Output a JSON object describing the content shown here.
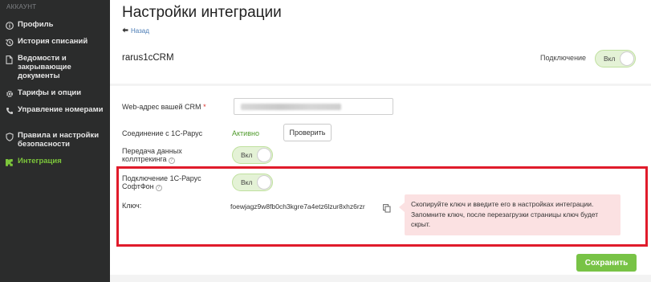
{
  "sidebar": {
    "section_label": "АККАУНТ",
    "items": [
      {
        "label": "Профиль",
        "icon": "info-circle-icon"
      },
      {
        "label": "История списаний",
        "icon": "history-icon"
      },
      {
        "label": "Ведомости и закрывающие документы",
        "icon": "document-icon"
      },
      {
        "label": "Тарифы и опции",
        "icon": "gear-icon"
      },
      {
        "label": "Управление номерами",
        "icon": "phone-icon"
      },
      {
        "label": "Правила и настройки безопасности",
        "icon": "shield-icon"
      },
      {
        "label": "Интеграция",
        "icon": "puzzle-icon",
        "active": true
      }
    ]
  },
  "header": {
    "title": "Настройки интеграции",
    "back_label": "Назад",
    "integration_name": "rarus1cCRM",
    "connection_label": "Подключение",
    "connection_toggle": "Вкл"
  },
  "form": {
    "crm_url_label": "Web-адрес вашей CRM",
    "crm_url_required_mark": "*",
    "connection_status_label": "Соединение с 1С-Рарус",
    "connection_status_value": "Активно",
    "check_button": "Проверить",
    "calltracking_label": "Передача данных коллтрекинга",
    "calltracking_toggle": "Вкл",
    "softphone_label": "Подключение 1С-Рарус СофтФон",
    "softphone_toggle": "Вкл",
    "key_label": "Ключ:",
    "key_value": "foewjagz9w8fb0ch3kgre7a4etz6lzur8xhz6rzr",
    "key_hint": "Скопируйте ключ и введите его в настройках интеграции. Запомните ключ, после перезагрузки страницы ключ будет скрыт."
  },
  "actions": {
    "save_label": "Сохранить"
  },
  "colors": {
    "sidebar_bg": "#2b2c2c",
    "active_green": "#7cc63b",
    "save_green": "#78c346",
    "highlight_red": "#e01b2b",
    "hint_bg": "#fbe1e2",
    "link_blue": "#4a7bb5"
  }
}
